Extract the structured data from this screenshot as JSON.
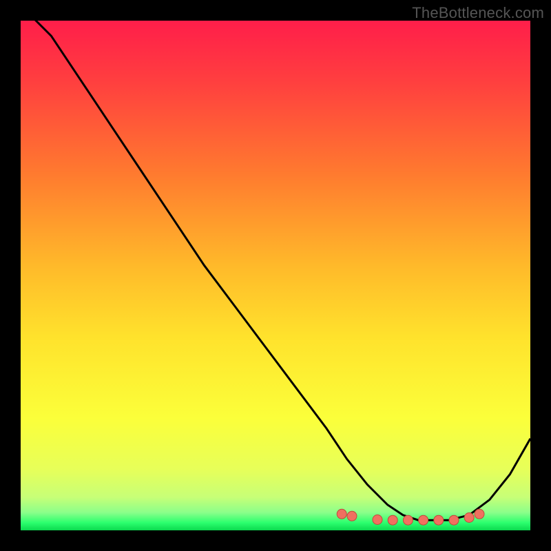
{
  "watermark": "TheBottleneck.com",
  "chart_data": {
    "type": "line",
    "title": "",
    "xlabel": "",
    "ylabel": "",
    "xlim": [
      0,
      100
    ],
    "ylim": [
      0,
      100
    ],
    "grid": false,
    "legend": false,
    "series": [
      {
        "name": "curve",
        "x": [
          0,
          6,
          12,
          18,
          24,
          30,
          36,
          42,
          48,
          54,
          60,
          64,
          68,
          72,
          75,
          78,
          81,
          84,
          88,
          92,
          96,
          100
        ],
        "y": [
          103,
          97,
          88,
          79,
          70,
          61,
          52,
          44,
          36,
          28,
          20,
          14,
          9,
          5,
          3,
          2,
          2,
          2,
          3,
          6,
          11,
          18
        ]
      },
      {
        "name": "dots",
        "x": [
          63,
          65,
          70,
          73,
          76,
          79,
          82,
          85,
          88,
          90
        ],
        "y": [
          3.2,
          2.8,
          2.1,
          2.0,
          2.0,
          2.0,
          2.0,
          2.0,
          2.5,
          3.2
        ]
      }
    ],
    "gradient_stops": [
      {
        "offset": 0.0,
        "color": "#ff1e4a"
      },
      {
        "offset": 0.12,
        "color": "#ff3f3f"
      },
      {
        "offset": 0.3,
        "color": "#ff7a2f"
      },
      {
        "offset": 0.48,
        "color": "#ffb92a"
      },
      {
        "offset": 0.62,
        "color": "#ffe22c"
      },
      {
        "offset": 0.78,
        "color": "#fbff3a"
      },
      {
        "offset": 0.88,
        "color": "#e7ff59"
      },
      {
        "offset": 0.935,
        "color": "#c7ff77"
      },
      {
        "offset": 0.965,
        "color": "#8bff8a"
      },
      {
        "offset": 0.985,
        "color": "#2cff6e"
      },
      {
        "offset": 1.0,
        "color": "#0bd94e"
      }
    ],
    "colors": {
      "curve": "#000000",
      "dot_fill": "#f07060",
      "dot_stroke": "#c04a3a"
    }
  }
}
